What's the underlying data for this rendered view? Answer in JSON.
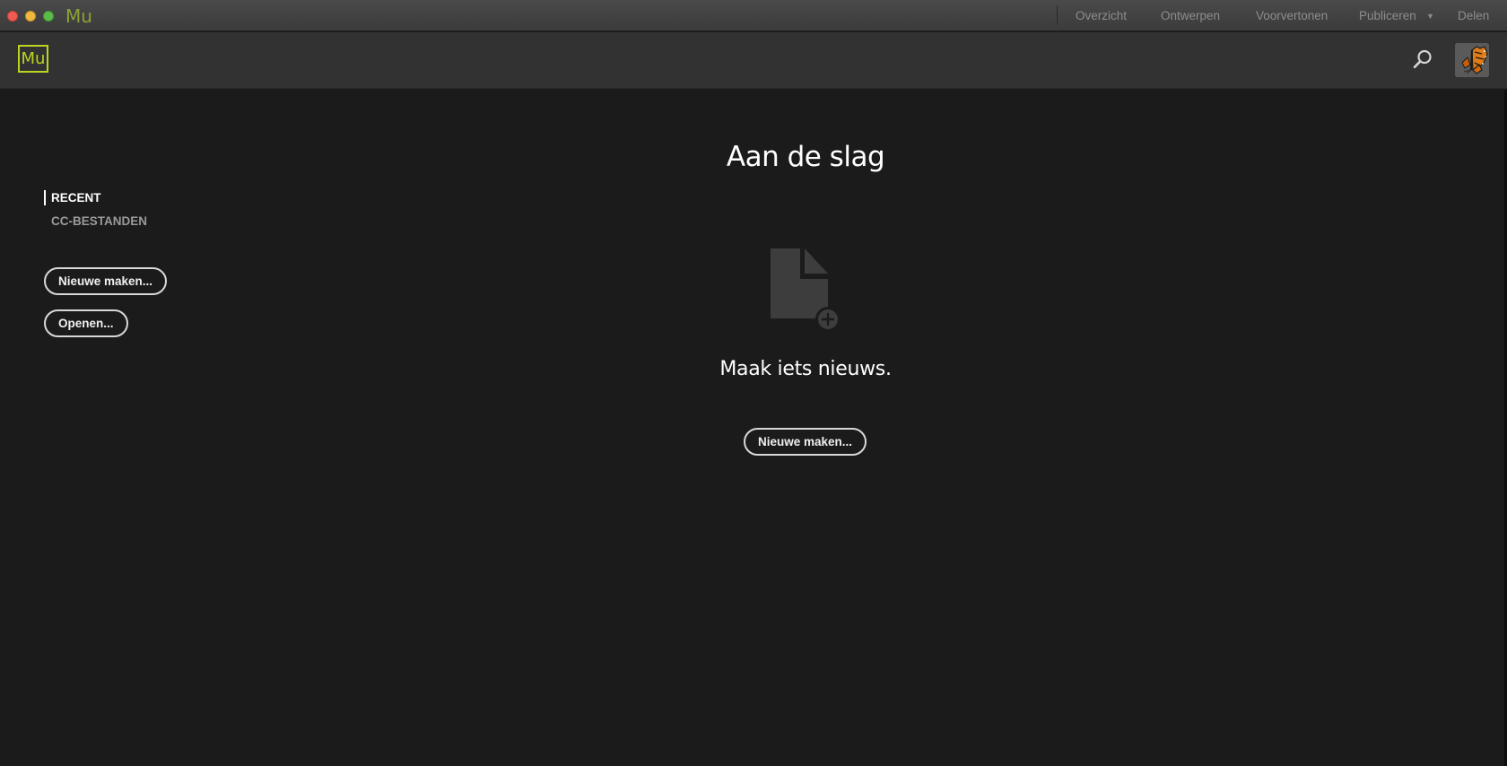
{
  "titlebar": {
    "app_name": "Mu",
    "nav": {
      "overzicht": "Overzicht",
      "ontwerpen": "Ontwerpen",
      "voorvertonen": "Voorvertonen",
      "publiceren": "Publiceren",
      "delen": "Delen"
    }
  },
  "header": {
    "logo_text": "Mu",
    "search_icon": "search-icon",
    "avatar_icon": "butterfly-avatar"
  },
  "sidebar": {
    "tabs": [
      {
        "label": "RECENT",
        "active": true
      },
      {
        "label": "CC-BESTANDEN",
        "active": false
      }
    ],
    "new_button": "Nieuwe maken...",
    "open_button": "Openen..."
  },
  "main": {
    "title": "Aan de slag",
    "subtitle": "Maak iets nieuws.",
    "new_button": "Nieuwe maken...",
    "icon": "new-document-icon"
  },
  "colors": {
    "background": "#1b1b1b",
    "header": "#323232",
    "brand_accent": "#bcd420"
  }
}
